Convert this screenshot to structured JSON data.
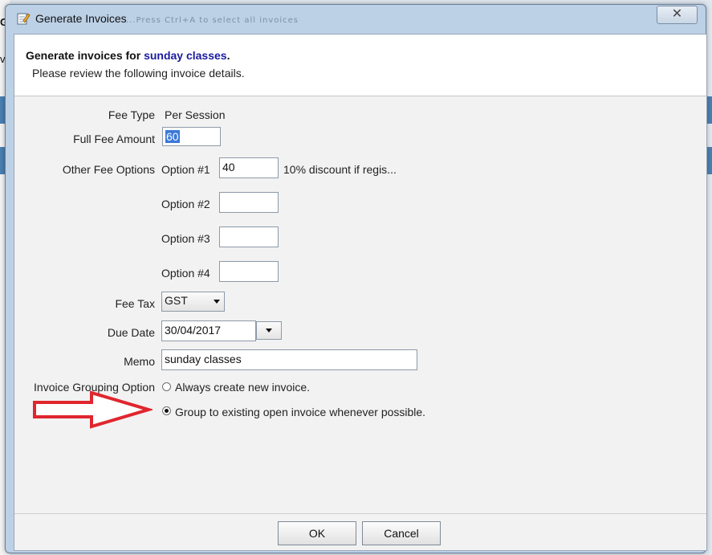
{
  "window": {
    "title": "Generate Invoices",
    "background_hint": "...Press Ctrl+A to select all invoices",
    "close_symbol": "✕"
  },
  "header": {
    "title_prefix": "Generate invoices for",
    "title_entity": "sunday classes",
    "title_suffix": ".",
    "subtitle": "Please review the following invoice details."
  },
  "form": {
    "fee_type_label": "Fee Type",
    "fee_type_value": "Per Session",
    "full_fee_label": "Full Fee Amount",
    "full_fee_value": "60",
    "other_fee_label": "Other Fee Options",
    "options": [
      {
        "label": "Option #1",
        "value": "40",
        "description": "10% discount if regis..."
      },
      {
        "label": "Option #2",
        "value": "",
        "description": ""
      },
      {
        "label": "Option #3",
        "value": "",
        "description": ""
      },
      {
        "label": "Option #4",
        "value": "",
        "description": ""
      }
    ],
    "fee_tax_label": "Fee Tax",
    "fee_tax_value": "GST",
    "due_date_label": "Due Date",
    "due_date_value": "30/04/2017",
    "memo_label": "Memo",
    "memo_value": "sunday classes",
    "grouping_label": "Invoice Grouping Option",
    "grouping_options": [
      {
        "label": "Always create new invoice.",
        "selected": false
      },
      {
        "label": "Group to existing open invoice whenever possible.",
        "selected": true
      }
    ]
  },
  "buttons": {
    "ok": "OK",
    "cancel": "Cancel"
  },
  "background": {
    "left_char_1": "G",
    "left_char_2": "ve"
  },
  "colors": {
    "accent_text": "#1a1aa0",
    "annotation_arrow": "#e0262e",
    "selection": "#3b78d8"
  }
}
